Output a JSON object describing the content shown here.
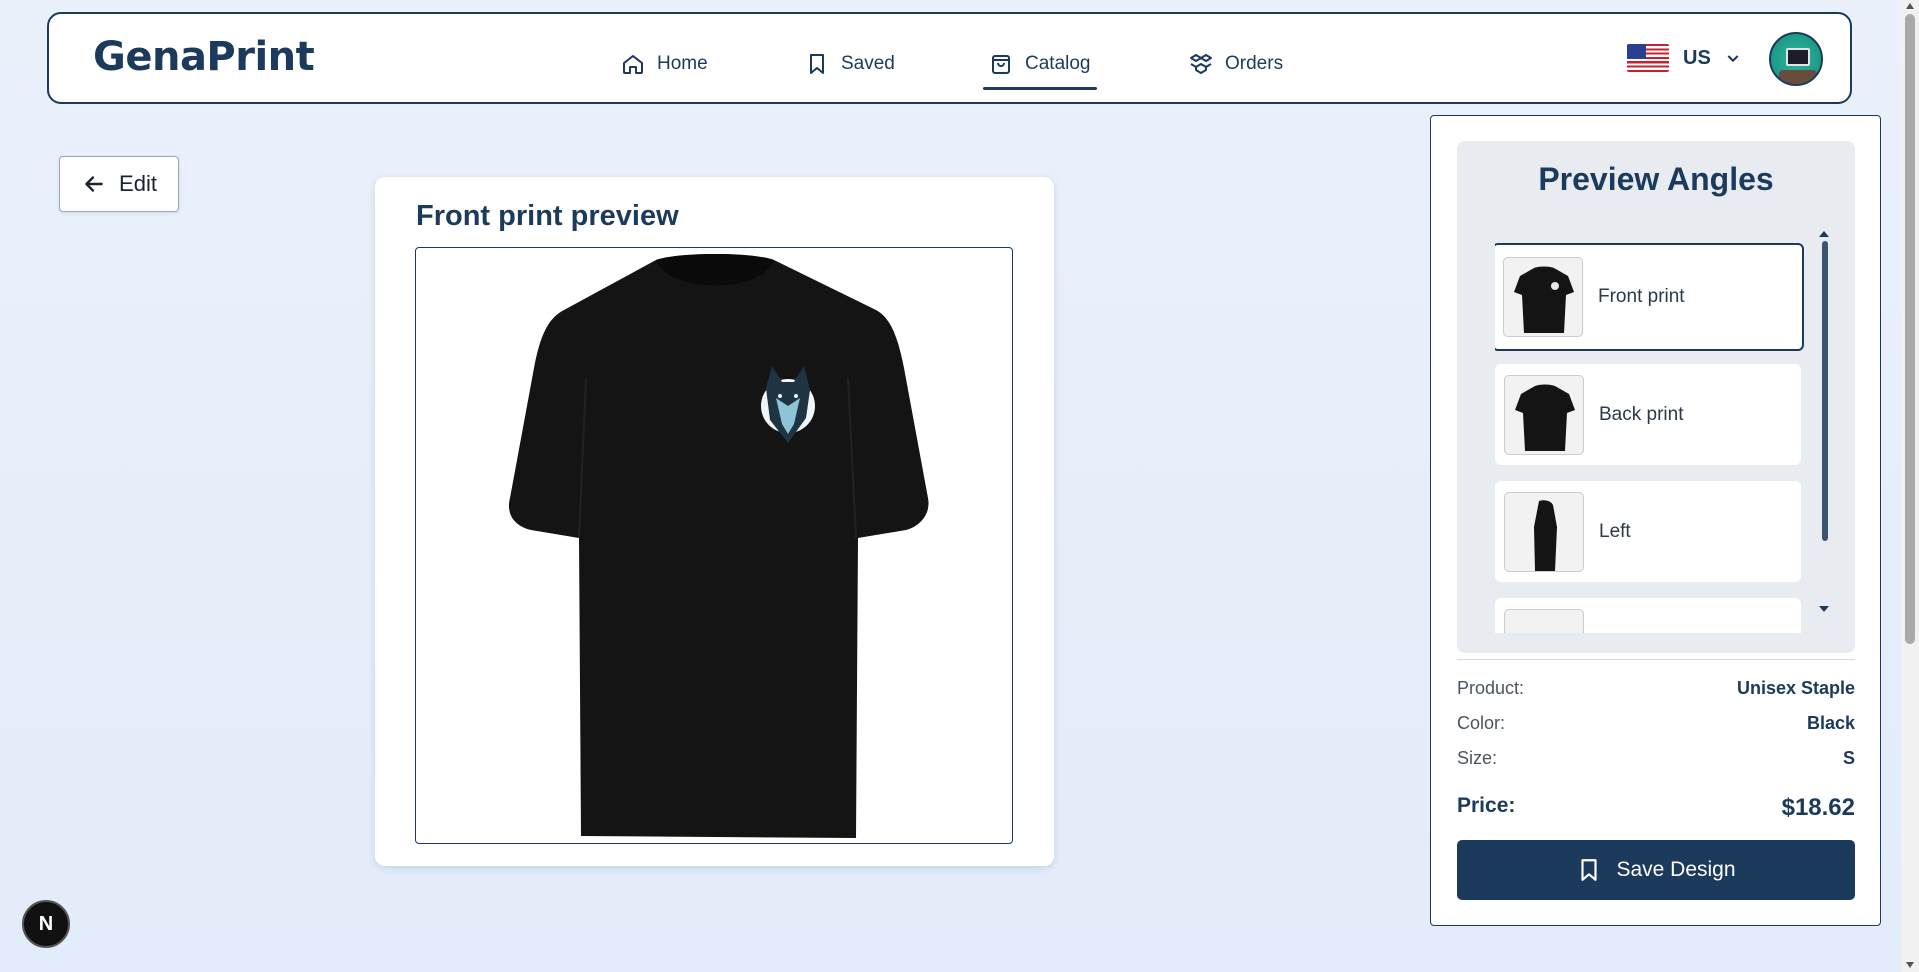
{
  "nav": {
    "logo": "GenaPrint",
    "links": [
      {
        "label": "Home",
        "icon": "home-icon"
      },
      {
        "label": "Saved",
        "icon": "bookmark-icon"
      },
      {
        "label": "Catalog",
        "icon": "shopping-bag-icon",
        "active": true
      },
      {
        "label": "Orders",
        "icon": "package-icon"
      }
    ],
    "language": {
      "label": "US",
      "icon": "us-flag-icon"
    },
    "avatar": "user-avatar"
  },
  "edit_button": {
    "label": "Edit"
  },
  "preview": {
    "title": "Front print preview",
    "product_color": "#141414"
  },
  "panel": {
    "title": "Preview Angles",
    "angles": [
      {
        "label": "Front print",
        "active": true
      },
      {
        "label": "Back print"
      },
      {
        "label": "Left"
      }
    ],
    "details": {
      "product_label": "Product:",
      "product_value": "Unisex Staple",
      "color_label": "Color:",
      "color_value": "Black",
      "size_label": "Size:",
      "size_value": "S",
      "price_label": "Price:",
      "price_value": "$18.62"
    },
    "save_label": "Save Design"
  },
  "floating_badge": "N",
  "colors": {
    "primary": "#1b3a5c",
    "background": "#e6eefa"
  }
}
